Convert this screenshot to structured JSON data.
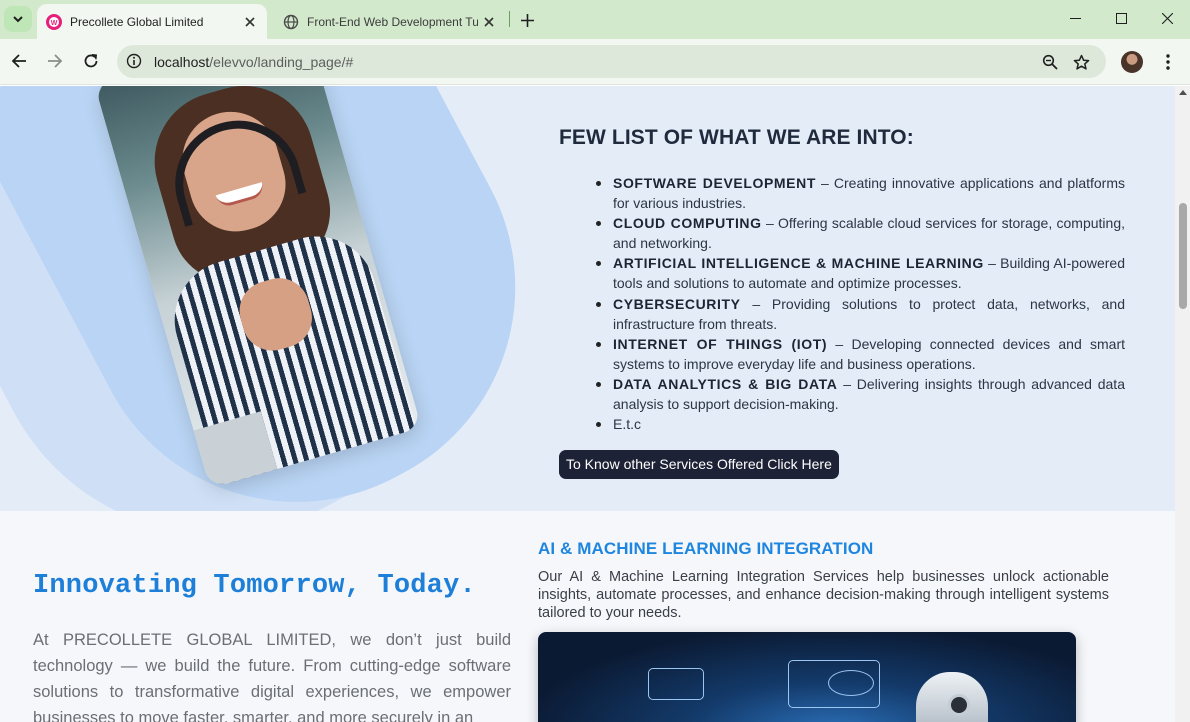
{
  "browser": {
    "tabs": [
      {
        "title": "Precollete Global Limited",
        "active": true
      },
      {
        "title": "Front-End Web Development Tu",
        "active": false
      }
    ],
    "url_host": "localhost",
    "url_path": "/elevvo/landing_page/#"
  },
  "services_section": {
    "heading": "FEW LIST OF WHAT WE ARE INTO:",
    "items": [
      {
        "name": "SOFTWARE DEVELOPMENT",
        "desc": " – Creating innovative applications and platforms for various industries."
      },
      {
        "name": "CLOUD COMPUTING",
        "desc": " – Offering scalable cloud services for storage, computing, and networking."
      },
      {
        "name": "ARTIFICIAL INTELLIGENCE & MACHINE LEARNING",
        "desc": " – Building AI-powered tools and solutions to automate and optimize processes."
      },
      {
        "name": "CYBERSECURITY",
        "desc": " – Providing solutions to protect data, networks, and infrastructure from threats."
      },
      {
        "name": "INTERNET OF THINGS (IOT)",
        "desc": " – Developing connected devices and smart systems to improve everyday life and business operations."
      },
      {
        "name": "DATA ANALYTICS & BIG DATA",
        "desc": " – Delivering insights through advanced data analysis to support decision-making."
      },
      {
        "name": "",
        "desc": "E.t.c"
      }
    ],
    "cta_label": "To Know other Services Offered Click Here"
  },
  "hero": {
    "title": "Innovating Tomorrow, Today.",
    "text": "At PRECOLLETE GLOBAL LIMITED, we don’t just build technology — we build the future. From cutting-edge software solutions to transformative digital experiences, we empower businesses to move faster, smarter, and more securely in an"
  },
  "ai_feature": {
    "heading": "AI & MACHINE LEARNING INTEGRATION",
    "text": "Our AI & Machine Learning Integration Services help businesses unlock actionable insights, automate processes, and enhance decision-making through intelligent systems tailored to your needs."
  },
  "colors": {
    "accent_blue": "#1e7fd8",
    "cta_bg": "#1d2236",
    "section_bg": "#e4ecf8",
    "tabbar_bg": "#d3e9cc"
  }
}
